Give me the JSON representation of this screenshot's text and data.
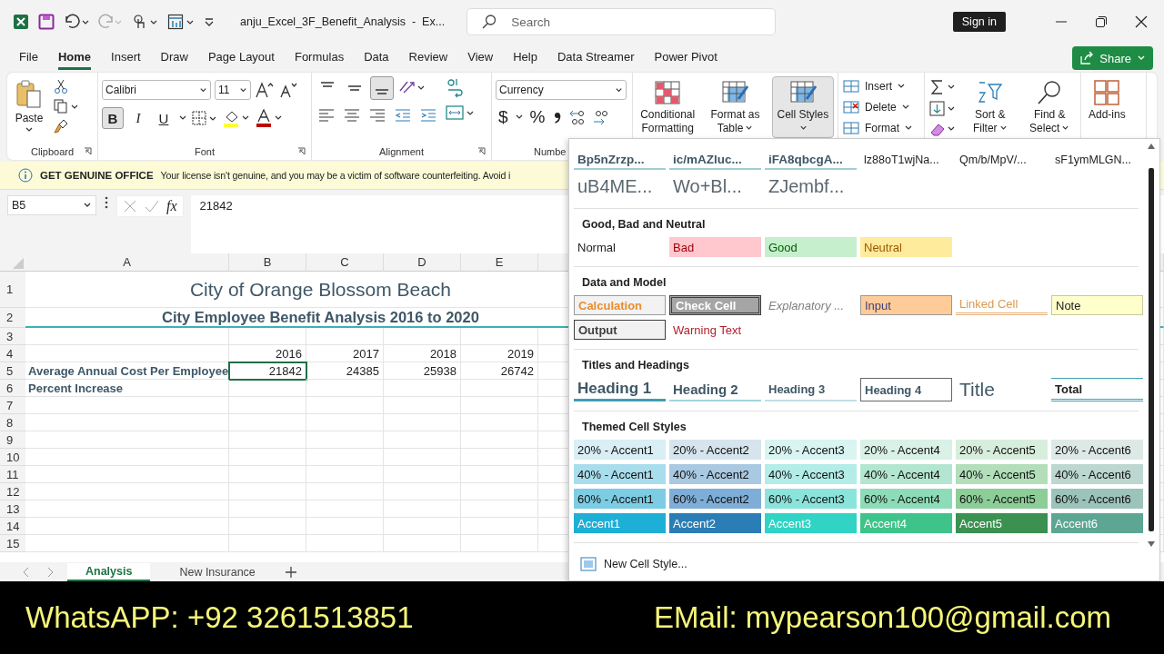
{
  "titlebar": {
    "title": "anju_Excel_3F_Benefit_Analysis  -  Ex...",
    "search": {
      "placeholder": "Search"
    },
    "sign_in": "Sign in"
  },
  "tabs": [
    {
      "label": "File",
      "selected": false
    },
    {
      "label": "Home",
      "selected": true
    },
    {
      "label": "Insert",
      "selected": false
    },
    {
      "label": "Draw",
      "selected": false
    },
    {
      "label": "Page Layout",
      "selected": false
    },
    {
      "label": "Formulas",
      "selected": false
    },
    {
      "label": "Data",
      "selected": false
    },
    {
      "label": "Review",
      "selected": false
    },
    {
      "label": "View",
      "selected": false
    },
    {
      "label": "Help",
      "selected": false
    },
    {
      "label": "Data Streamer",
      "selected": false
    },
    {
      "label": "Power Pivot",
      "selected": false
    }
  ],
  "share": "Share",
  "ribbon": {
    "clipboard": {
      "paste": "Paste",
      "label": "Clipboard"
    },
    "font": {
      "name": "Calibri",
      "size": "11",
      "bold": {
        "label": "B",
        "on": true
      },
      "italic": {
        "label": "I",
        "on": false
      },
      "underline": {
        "label": "U",
        "on": false
      },
      "label": "Font"
    },
    "alignment": {
      "vertical": [
        {
          "selected": false
        },
        {
          "selected": false
        },
        {
          "selected": true
        }
      ],
      "label": "Alignment"
    },
    "number": {
      "format": "Currency",
      "currency": "$",
      "percent": "%",
      "label": "Numbe"
    },
    "styles": [
      {
        "label": "Conditional Formatting",
        "selected": false
      },
      {
        "label": "Format as Table",
        "selected": false
      },
      {
        "label": "Cell Styles",
        "selected": true
      }
    ],
    "cells": [
      "Insert",
      "Delete",
      "Format"
    ],
    "editing": [
      "Sort & Filter",
      "Find & Select"
    ],
    "addins": "Add-ins"
  },
  "banner": {
    "title": "GET GENUINE OFFICE",
    "message": "Your license isn't genuine, and you may be a victim of software counterfeiting. Avoid i"
  },
  "formula_bar": {
    "name_box": "B5",
    "function_label": "fx",
    "value": "21842"
  },
  "sheet": {
    "columns": [
      "A",
      "B",
      "C",
      "D",
      "E"
    ],
    "rows": [
      {
        "n": "1",
        "kind": "title",
        "text": "City of Orange Blossom Beach"
      },
      {
        "n": "2",
        "kind": "subtitle",
        "text": "City Employee Benefit Analysis 2016 to 2020"
      },
      {
        "n": "3",
        "kind": "data"
      },
      {
        "n": "4",
        "kind": "data",
        "values": [
          {
            "text": "2016",
            "selected": false
          },
          {
            "text": "2017",
            "selected": false
          },
          {
            "text": "2018",
            "selected": false
          },
          {
            "text": "2019",
            "selected": false
          }
        ]
      },
      {
        "n": "5",
        "kind": "data",
        "label": "Average Annual Cost Per Employee",
        "values": [
          {
            "text": "21842",
            "selected": true
          },
          {
            "text": "24385",
            "selected": false
          },
          {
            "text": "25938",
            "selected": false
          },
          {
            "text": "26742",
            "selected": false
          }
        ]
      },
      {
        "n": "6",
        "kind": "data",
        "label": "Percent Increase"
      },
      {
        "n": "7",
        "kind": "data"
      },
      {
        "n": "8",
        "kind": "data"
      },
      {
        "n": "9",
        "kind": "data"
      },
      {
        "n": "10",
        "kind": "data"
      },
      {
        "n": "11",
        "kind": "data"
      },
      {
        "n": "12",
        "kind": "data"
      },
      {
        "n": "13",
        "kind": "data"
      },
      {
        "n": "14",
        "kind": "data"
      },
      {
        "n": "15",
        "kind": "data"
      }
    ],
    "tabs": [
      {
        "label": "Analysis",
        "selected": true
      },
      {
        "label": "New Insurance",
        "selected": false
      }
    ]
  },
  "menu": {
    "custom": [
      {
        "label": "Bp5nZrzp...",
        "kind": "heading"
      },
      {
        "label": "ic/mAZluc...",
        "kind": "heading"
      },
      {
        "label": "iFA8qbcgA...",
        "kind": "heading"
      },
      {
        "label": "lz88oT1wjNa...",
        "kind": "plain"
      },
      {
        "label": "Qm/b/MpV/...",
        "kind": "plain"
      },
      {
        "label": "sF1ymMLGN...",
        "kind": "plain"
      },
      {
        "label": "uB4ME...",
        "kind": "big"
      },
      {
        "label": "Wo+Bl...",
        "kind": "big"
      },
      {
        "label": "ZJembf...",
        "kind": "big"
      }
    ],
    "sections": [
      {
        "title": "Good, Bad and Neutral",
        "styles": [
          {
            "label": "Normal",
            "kind": "normal"
          },
          {
            "label": "Bad",
            "kind": "bad"
          },
          {
            "label": "Good",
            "kind": "good"
          },
          {
            "label": "Neutral",
            "kind": "neutral"
          }
        ]
      },
      {
        "title": "Data and Model",
        "styles": [
          {
            "label": "Calculation",
            "kind": "calculation"
          },
          {
            "label": "Check Cell",
            "kind": "check"
          },
          {
            "label": "Explanatory ...",
            "kind": "explanatory"
          },
          {
            "label": "Input",
            "kind": "input"
          },
          {
            "label": "Linked Cell",
            "kind": "linked"
          },
          {
            "label": "Note",
            "kind": "note"
          },
          {
            "label": "Output",
            "kind": "output"
          },
          {
            "label": "Warning Text",
            "kind": "warning"
          }
        ]
      },
      {
        "title": "Titles and Headings",
        "styles": [
          {
            "label": "Heading 1",
            "kind": "h1",
            "selected": false
          },
          {
            "label": "Heading 2",
            "kind": "h2",
            "selected": false
          },
          {
            "label": "Heading 3",
            "kind": "h3",
            "selected": false
          },
          {
            "label": "Heading 4",
            "kind": "h4",
            "selected": true
          },
          {
            "label": "Title",
            "kind": "title",
            "selected": false
          },
          {
            "label": "Total",
            "kind": "total",
            "selected": false
          }
        ]
      },
      {
        "title": "Themed Cell Styles",
        "styles": [
          {
            "label": "20% - Accent1",
            "kind": "accent",
            "color": "#d9eef5"
          },
          {
            "label": "20% - Accent2",
            "kind": "accent",
            "color": "#d6e4ee"
          },
          {
            "label": "20% - Accent3",
            "kind": "accent",
            "color": "#d8f5f2"
          },
          {
            "label": "20% - Accent4",
            "kind": "accent",
            "color": "#d9f1e6"
          },
          {
            "label": "20% - Accent5",
            "kind": "accent",
            "color": "#d8eedc"
          },
          {
            "label": "20% - Accent6",
            "kind": "accent",
            "color": "#dde9e6"
          },
          {
            "label": "40% - Accent1",
            "kind": "accent",
            "color": "#a8dded"
          },
          {
            "label": "40% - Accent2",
            "kind": "accent",
            "color": "#a9c8e2"
          },
          {
            "label": "40% - Accent3",
            "kind": "accent",
            "color": "#b2ede8"
          },
          {
            "label": "40% - Accent4",
            "kind": "accent",
            "color": "#b3e6d0"
          },
          {
            "label": "40% - Accent5",
            "kind": "accent",
            "color": "#b2deba"
          },
          {
            "label": "40% - Accent6",
            "kind": "accent",
            "color": "#bcd6d0"
          },
          {
            "label": "60% - Accent1",
            "kind": "accent",
            "color": "#7ccde4"
          },
          {
            "label": "60% - Accent2",
            "kind": "accent",
            "color": "#7eaed7"
          },
          {
            "label": "60% - Accent3",
            "kind": "accent",
            "color": "#8be4dc"
          },
          {
            "label": "60% - Accent4",
            "kind": "accent",
            "color": "#8ddcb8"
          },
          {
            "label": "60% - Accent5",
            "kind": "accent",
            "color": "#8ccd98"
          },
          {
            "label": "60% - Accent6",
            "kind": "accent",
            "color": "#9cc3ba"
          },
          {
            "label": "Accent1",
            "kind": "accent-strong",
            "color": "#1eafd6"
          },
          {
            "label": "Accent2",
            "kind": "accent-strong",
            "color": "#2a7db5"
          },
          {
            "label": "Accent3",
            "kind": "accent-strong",
            "color": "#30d3c4"
          },
          {
            "label": "Accent4",
            "kind": "accent-strong",
            "color": "#3ec48a"
          },
          {
            "label": "Accent5",
            "kind": "accent-strong",
            "color": "#3a9150"
          },
          {
            "label": "Accent6",
            "kind": "accent-strong",
            "color": "#5ca693"
          }
        ]
      }
    ],
    "new_style": "New Cell Style..."
  },
  "footer": {
    "whatsapp": "WhatsAPP: +92 3261513851",
    "email": "EMail: mypearson100@gmail.com"
  }
}
